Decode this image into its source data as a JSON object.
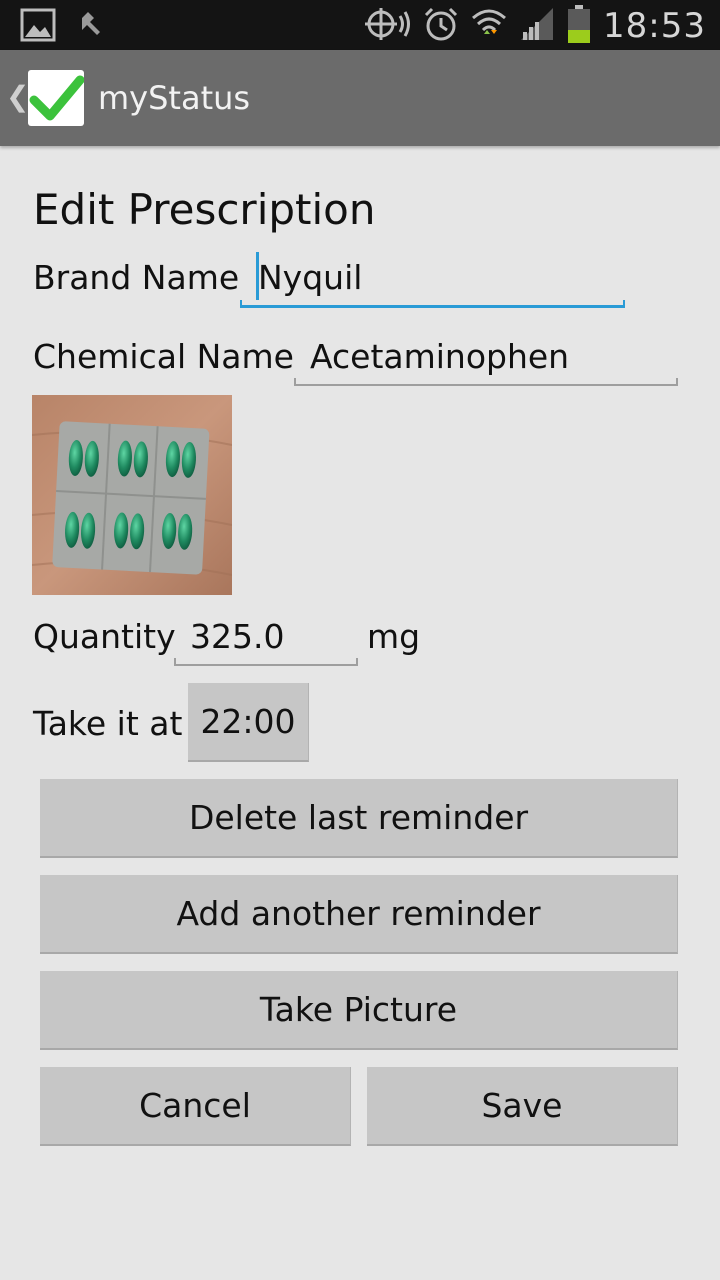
{
  "status_bar": {
    "time": "18:53",
    "icons": [
      "gallery-icon",
      "tools-icon",
      "gps-icon",
      "alarm-icon",
      "wifi-icon",
      "signal-icon",
      "battery-icon"
    ]
  },
  "action_bar": {
    "back_glyph": "❮",
    "title": "myStatus",
    "logo_icon": "checkmark-icon"
  },
  "form": {
    "heading": "Edit Prescription",
    "brand_label": "Brand Name",
    "brand_value": "Nyquil",
    "chemical_label": "Chemical Name",
    "chemical_value": "Acetaminophen",
    "photo_icon": "pill-blister-image",
    "quantity_label": "Quantity",
    "quantity_value": "325.0",
    "quantity_unit": "mg",
    "time_label": "Take it at",
    "time_value": "22:00"
  },
  "buttons": {
    "delete_reminder": "Delete last reminder",
    "add_reminder": "Add another reminder",
    "take_picture": "Take Picture",
    "cancel": "Cancel",
    "save": "Save"
  },
  "colors": {
    "focus_accent": "#2a9bd6",
    "action_bar": "#6b6b6b",
    "background": "#e6e6e6"
  }
}
